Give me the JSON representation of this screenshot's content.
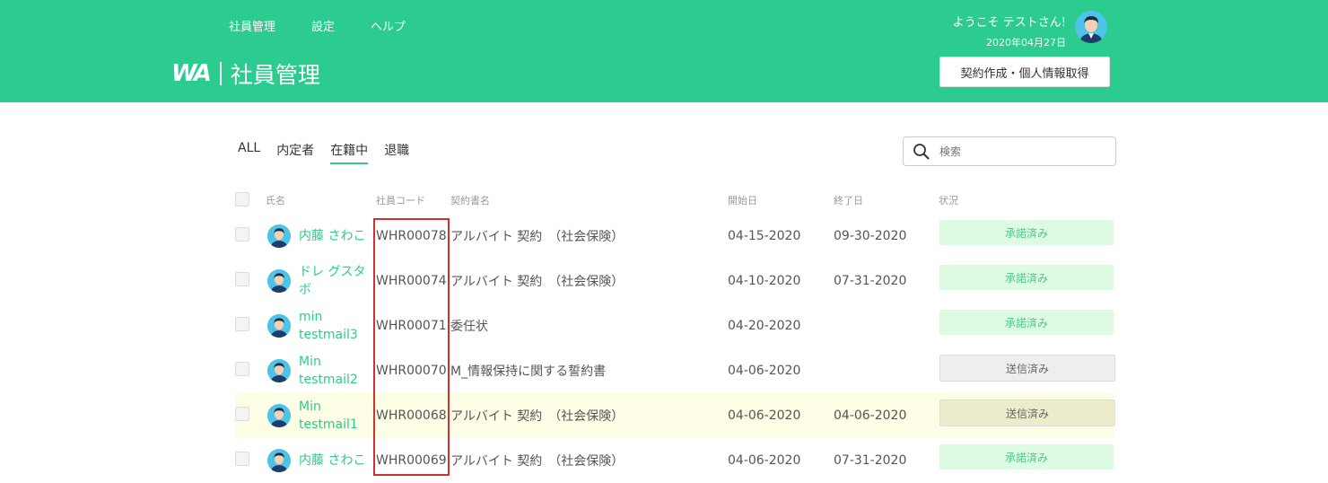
{
  "nav": [
    "社員管理",
    "設定",
    "ヘルプ"
  ],
  "brand": {
    "mark": "WA",
    "title": "社員管理"
  },
  "user": {
    "welcome": "ようこそ テストさん!",
    "date": "2020年04月27日"
  },
  "contract_button": "契約作成・個人情報取得",
  "tabs": [
    "ALL",
    "内定者",
    "在籍中",
    "退職"
  ],
  "active_tab": "在籍中",
  "search": {
    "placeholder": "検索"
  },
  "columns": {
    "name": "氏名",
    "code": "社員コード",
    "contract": "契約書名",
    "start": "開始日",
    "end": "終了日",
    "status": "状況"
  },
  "rows": [
    {
      "name1": "内藤 さわこ",
      "name2": "",
      "code": "WHR00078",
      "contract": "アルバイト 契約　（社会保険）",
      "start": "04-15-2020",
      "end": "09-30-2020",
      "status": "承諾済み"
    },
    {
      "name1": "ドレ グスタ",
      "name2": "ボ",
      "code": "WHR00074",
      "contract": "アルバイト 契約　（社会保険）",
      "start": "04-10-2020",
      "end": "07-31-2020",
      "status": "承諾済み"
    },
    {
      "name1": "min",
      "name2": "testmail3",
      "code": "WHR00071",
      "contract": "委任状",
      "start": "04-20-2020",
      "end": "",
      "status": "承諾済み"
    },
    {
      "name1": "Min",
      "name2": "testmail2",
      "code": "WHR00070",
      "contract": "M_情報保持に関する誓約書",
      "start": "04-06-2020",
      "end": "",
      "status": "送信済み"
    },
    {
      "name1": "Min",
      "name2": "testmail1",
      "code": "WHR00068",
      "contract": "アルバイト 契約　（社会保険）",
      "start": "04-06-2020",
      "end": "04-06-2020",
      "status": "送信済み"
    },
    {
      "name1": "内藤 さわこ",
      "name2": "",
      "code": "WHR00069",
      "contract": "アルバイト 契約　（社会保険）",
      "start": "04-06-2020",
      "end": "07-31-2020",
      "status": "承諾済み"
    }
  ],
  "colors": {
    "accent": "#2ccb8f",
    "highlight_row": "#fefde6",
    "annotation": "#d32f2f"
  }
}
